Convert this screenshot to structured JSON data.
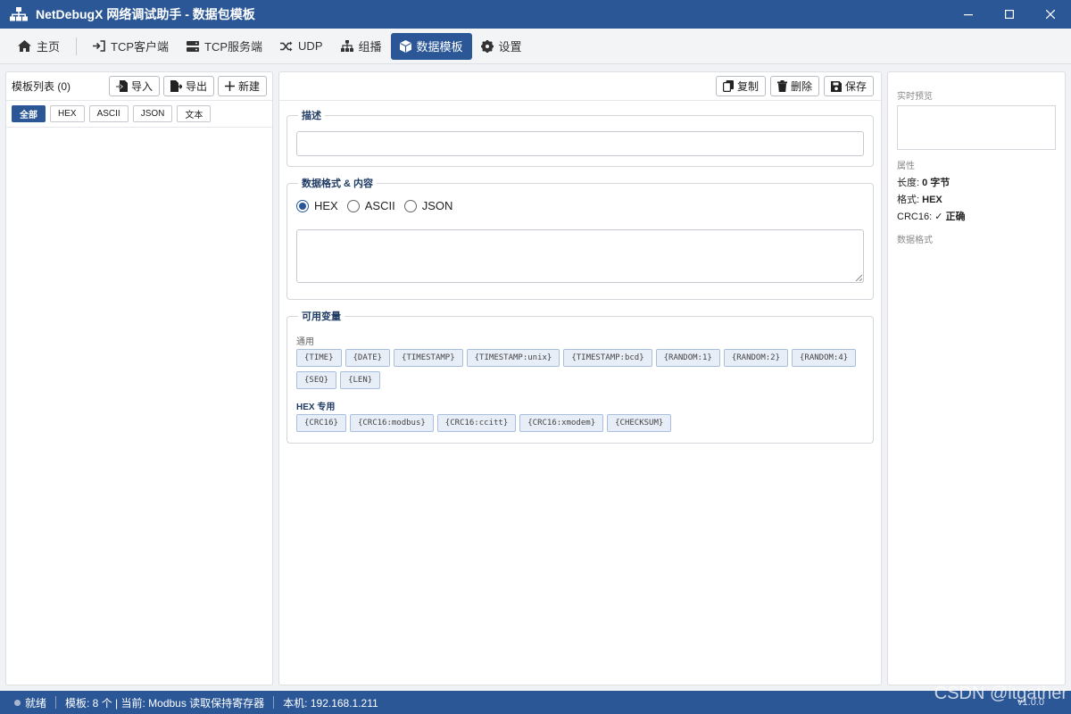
{
  "window": {
    "title": "NetDebugX 网络调试助手 - 数据包模板"
  },
  "nav": {
    "items": [
      {
        "label": "主页",
        "icon": "home-icon"
      },
      {
        "label": "TCP客户端",
        "icon": "login-arrow-icon"
      },
      {
        "label": "TCP服务端",
        "icon": "server-icon"
      },
      {
        "label": "UDP",
        "icon": "shuffle-icon"
      },
      {
        "label": "组播",
        "icon": "sitemap-icon"
      },
      {
        "label": "数据模板",
        "icon": "cube-icon",
        "active": true
      },
      {
        "label": "设置",
        "icon": "gear-icon"
      }
    ]
  },
  "left": {
    "title": "模板列表 (0)",
    "import_label": "导入",
    "export_label": "导出",
    "new_label": "新建",
    "filters": [
      "全部",
      "HEX",
      "ASCII",
      "JSON",
      "文本"
    ]
  },
  "center": {
    "copy_label": "复制",
    "delete_label": "删除",
    "save_label": "保存",
    "desc_legend": "描述",
    "desc_value": "",
    "format_legend": "数据格式 & 内容",
    "formats": [
      "HEX",
      "ASCII",
      "JSON"
    ],
    "selected_format": "HEX",
    "content_value": "",
    "vars_legend": "可用变量",
    "general_label": "通用",
    "general_vars": [
      "{TIME}",
      "{DATE}",
      "{TIMESTAMP}",
      "{TIMESTAMP:unix}",
      "{TIMESTAMP:bcd}",
      "{RANDOM:1}",
      "{RANDOM:2}",
      "{RANDOM:4}",
      "{SEQ}",
      "{LEN}"
    ],
    "hex_label": "HEX 专用",
    "hex_vars": [
      "{CRC16}",
      "{CRC16:modbus}",
      "{CRC16:ccitt}",
      "{CRC16:xmodem}",
      "{CHECKSUM}"
    ]
  },
  "right": {
    "preview_label": "实时预览",
    "props_label": "属性",
    "length_key": "长度:",
    "length_value": "0 字节",
    "format_key": "格式:",
    "format_value": "HEX",
    "crc_key": "CRC16:",
    "crc_value": "✓ 正确",
    "dataformat_label": "数据格式"
  },
  "status": {
    "state": "就绪",
    "templates": "模板: 8 个 | 当前: Modbus 读取保持寄存器",
    "local": "本机: 192.168.1.211",
    "version": "v1.0.0"
  },
  "watermark": "CSDN @itgather",
  "colors": {
    "primary": "#2b5797",
    "chip_bg": "#e8eef8",
    "legend": "#1f3b63"
  }
}
